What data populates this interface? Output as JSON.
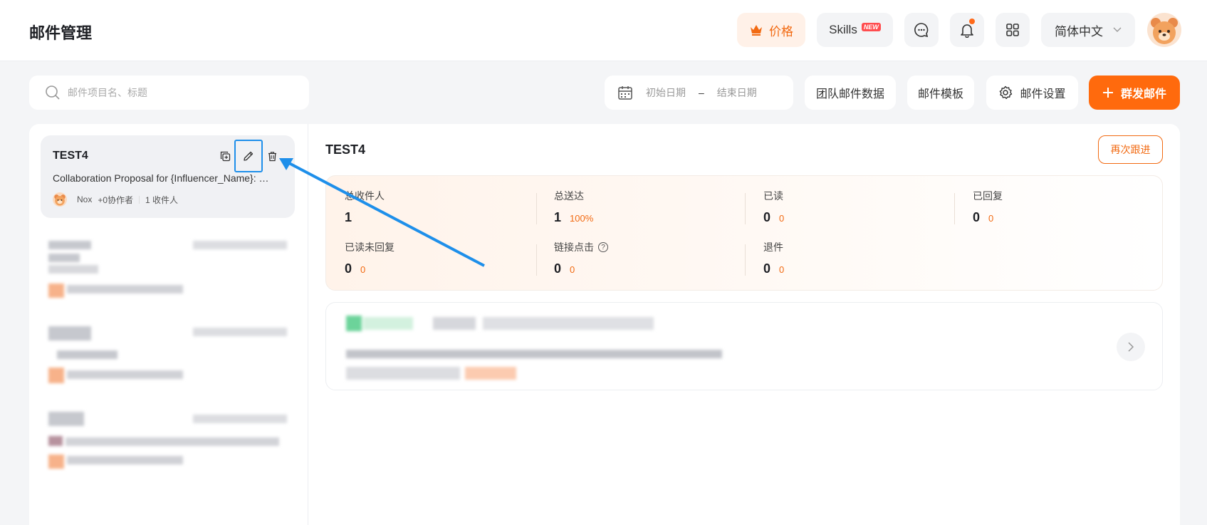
{
  "header": {
    "title": "邮件管理",
    "price_label": "价格",
    "skills_label": "Skills",
    "skills_badge": "NEW",
    "language": "简体中文",
    "bell_has_notification": true
  },
  "toolbar": {
    "search_placeholder": "邮件项目名、标题",
    "date_start_placeholder": "初始日期",
    "date_separator": "–",
    "date_end_placeholder": "结束日期",
    "team_data_label": "团队邮件数据",
    "template_label": "邮件模板",
    "settings_label": "邮件设置",
    "mass_send_label": "群发邮件"
  },
  "campaign_list": {
    "active_item": {
      "title": "TEST4",
      "subject": "Collaboration Proposal for {Influencer_Name}: …",
      "owner": "Nox",
      "collaborators": "+0协作者",
      "recipients": "1 收件人"
    }
  },
  "detail": {
    "title": "TEST4",
    "follow_up_label": "再次跟进",
    "stats": [
      {
        "label": "总收件人",
        "value": "1",
        "sub": ""
      },
      {
        "label": "总送达",
        "value": "1",
        "sub": "100%"
      },
      {
        "label": "已读",
        "value": "0",
        "sub": "0"
      },
      {
        "label": "已回复",
        "value": "0",
        "sub": "0"
      },
      {
        "label": "已读未回复",
        "value": "0",
        "sub": "0"
      },
      {
        "label": "链接点击",
        "value": "0",
        "sub": "0",
        "has_help": true
      },
      {
        "label": "退件",
        "value": "0",
        "sub": "0"
      }
    ]
  },
  "colors": {
    "accent": "#ff6a0d",
    "highlight_box": "#1e8fea",
    "arrow": "#1e8fea"
  }
}
